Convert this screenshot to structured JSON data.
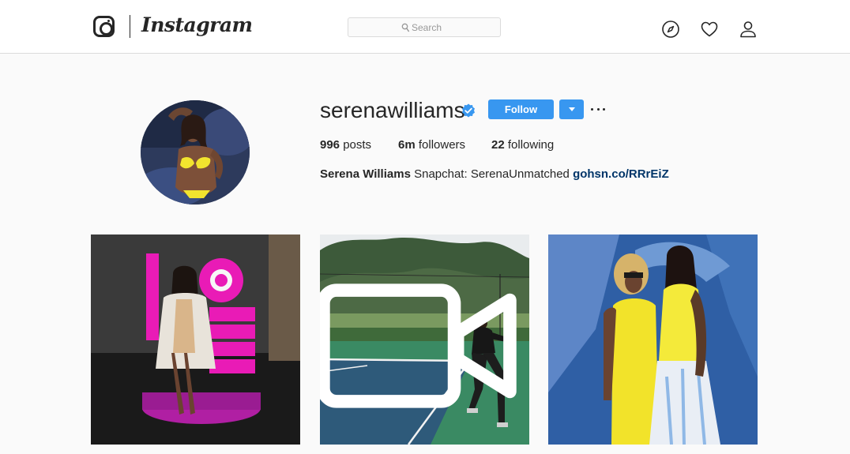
{
  "nav": {
    "brand": "Instagram",
    "search_placeholder": "Search",
    "icons": [
      "explore-compass-icon",
      "activity-heart-icon",
      "profile-person-icon"
    ]
  },
  "profile": {
    "username": "serenawilliams",
    "verified": true,
    "follow_label": "Follow",
    "stats": {
      "posts_count": "996",
      "posts_label": "posts",
      "followers_count": "6m",
      "followers_label": "followers",
      "following_count": "22",
      "following_label": "following"
    },
    "bio": {
      "full_name": "Serena Williams",
      "text": "Snapchat: SerenaUnmatched",
      "link": "gohsn.co/RRrEiZ"
    }
  },
  "posts": [
    {
      "type": "photo"
    },
    {
      "type": "video"
    },
    {
      "type": "photo"
    }
  ],
  "colors": {
    "accent_blue": "#3897f0",
    "link_blue": "#003569",
    "background": "#fafafa",
    "border": "#dbdbdb",
    "text": "#262626"
  }
}
